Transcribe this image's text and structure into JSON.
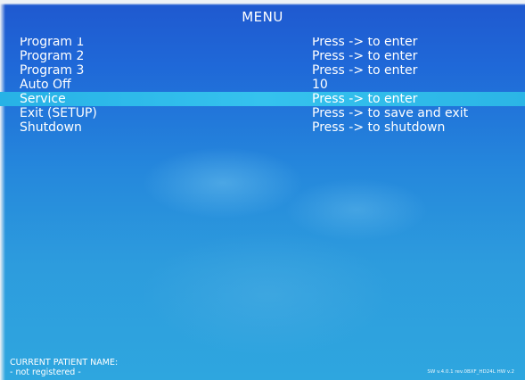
{
  "menu": {
    "title": "MENU",
    "items": [
      {
        "label": "Program 1",
        "value": "Press -> to enter"
      },
      {
        "label": "Program 2",
        "value": "Press -> to enter"
      },
      {
        "label": "Program 3",
        "value": "Press -> to enter"
      },
      {
        "label": "Auto Off",
        "value": "10"
      },
      {
        "label": "Service",
        "value": "Press -> to enter"
      },
      {
        "label": "Exit (SETUP)",
        "value": "Press -> to save and exit"
      },
      {
        "label": "Shutdown",
        "value": "Press -> to shutdown"
      }
    ],
    "selected_item": "Service"
  },
  "footer": {
    "patient_label": "CURRENT PATIENT NAME:",
    "patient_value": "- not registered -",
    "sw_info": "SW v.4.0.1 rev.0BXF_HD24L HW v.2"
  },
  "colors": {
    "background_top": "#1f58cf",
    "background_bottom": "#2ea6df",
    "selection_bar": "#35c2ee",
    "text": "#ffffff"
  }
}
